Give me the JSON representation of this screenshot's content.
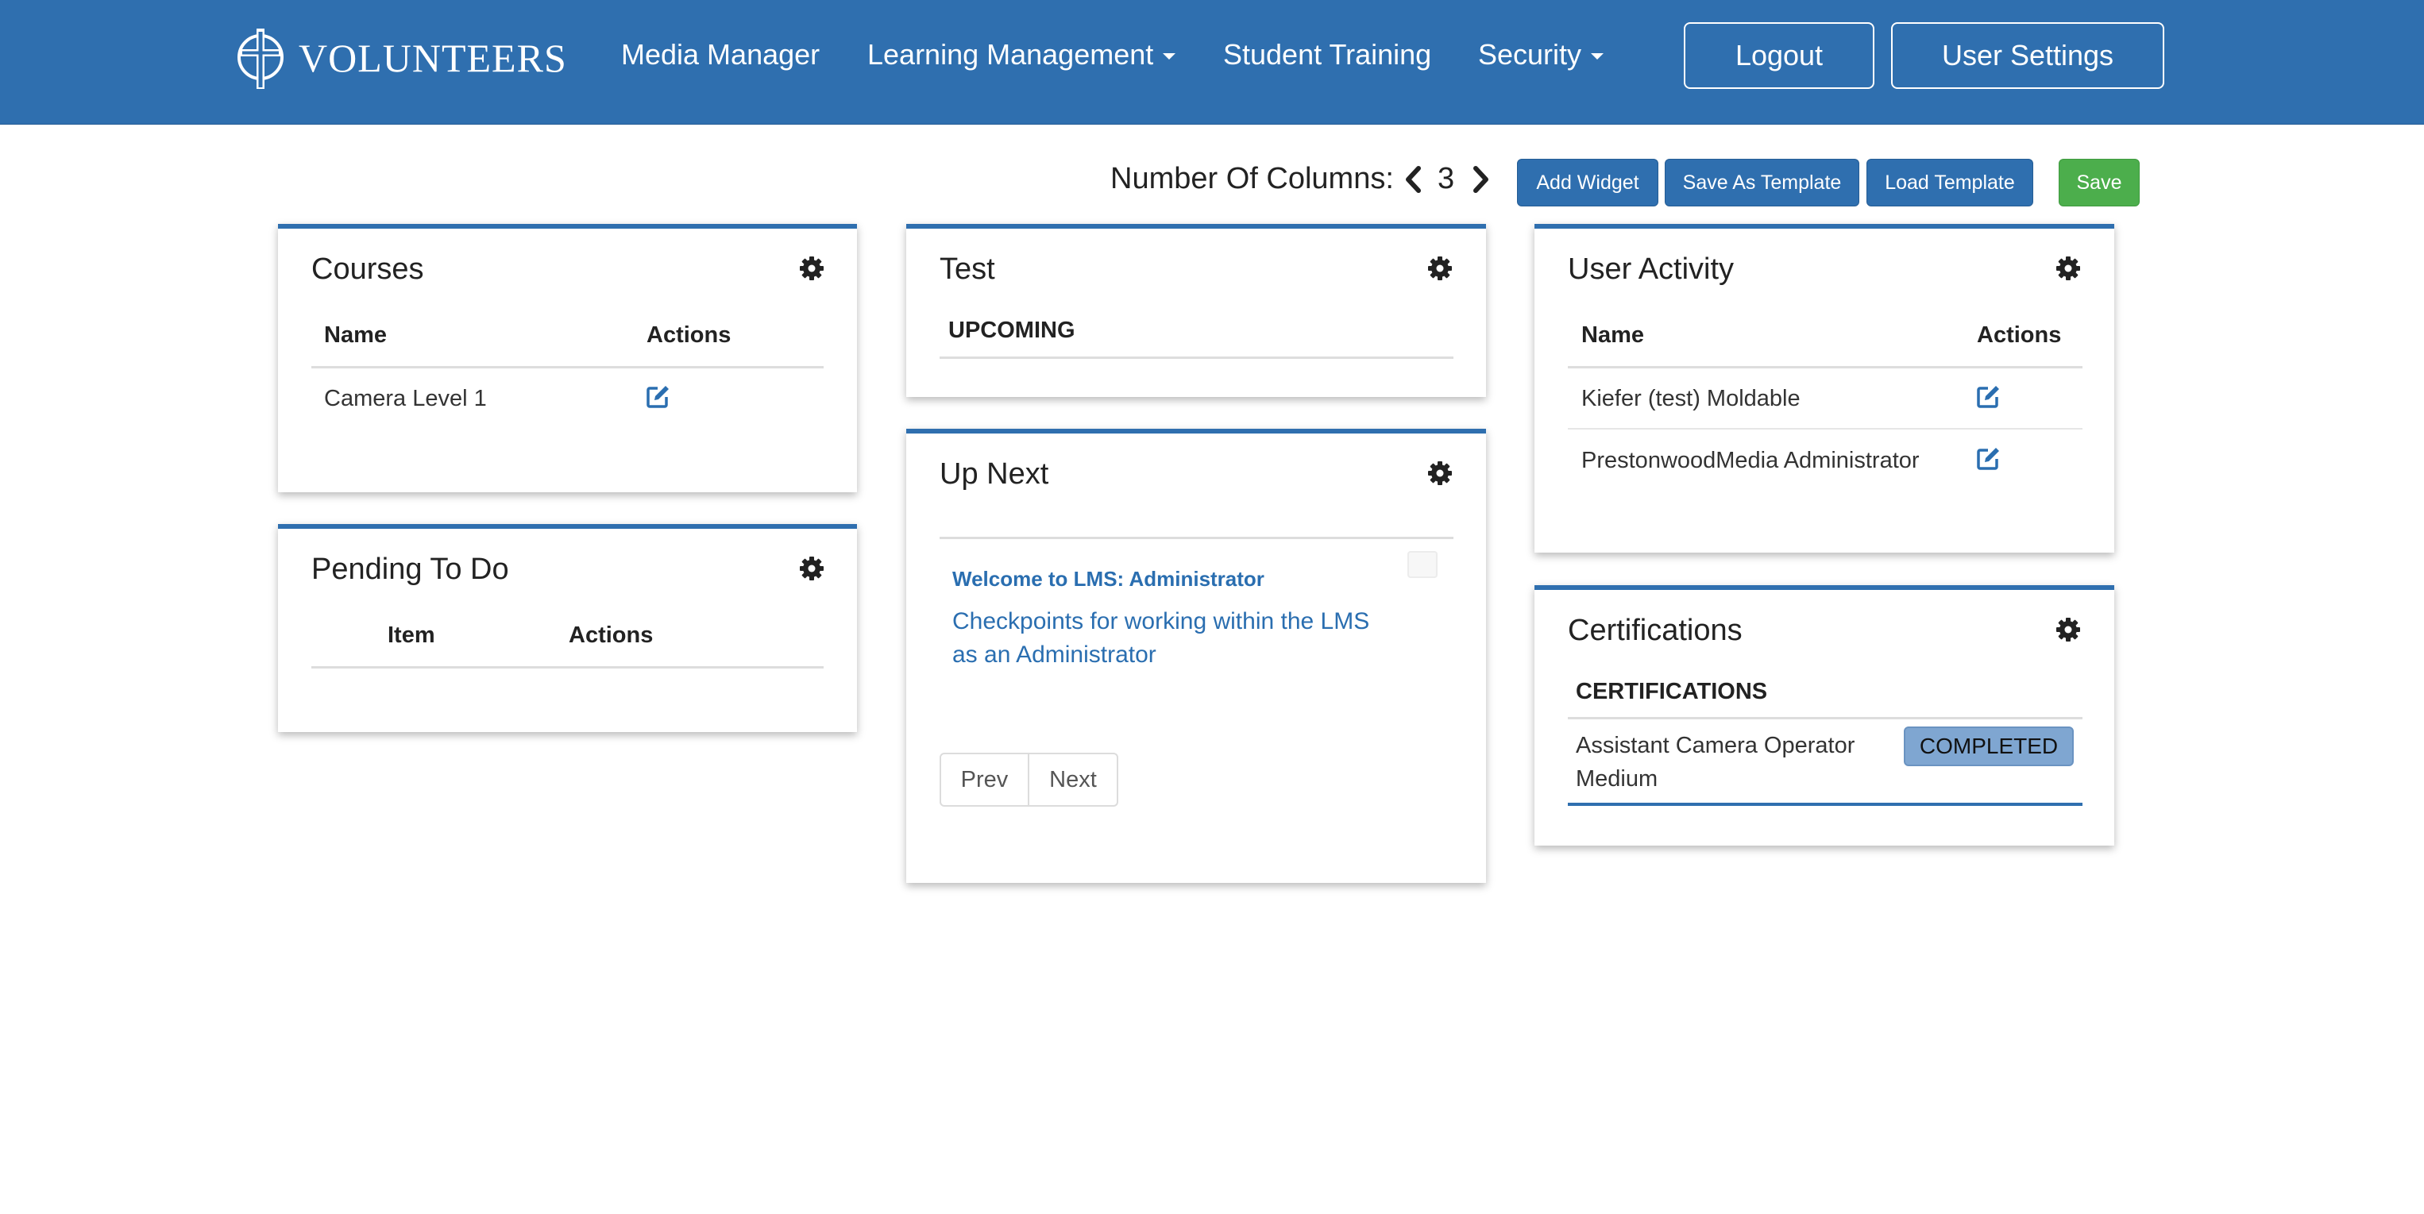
{
  "nav": {
    "brand": "VOLUNTEERS",
    "links": [
      {
        "label": "Media Manager",
        "dropdown": false
      },
      {
        "label": "Learning Management",
        "dropdown": true
      },
      {
        "label": "Student Training",
        "dropdown": false
      },
      {
        "label": "Security",
        "dropdown": true
      }
    ],
    "logout": "Logout",
    "user_settings": "User Settings"
  },
  "toolbar": {
    "columns_label": "Number Of Columns:",
    "columns_value": "3",
    "add_widget": "Add Widget",
    "save_as_template": "Save As Template",
    "load_template": "Load Template",
    "save": "Save"
  },
  "widgets": {
    "courses": {
      "title": "Courses",
      "headers": [
        "Name",
        "Actions"
      ],
      "rows": [
        {
          "name": "Camera Level 1"
        }
      ]
    },
    "pending": {
      "title": "Pending To Do",
      "headers": [
        "Item",
        "Actions"
      ]
    },
    "test": {
      "title": "Test",
      "header": "UPCOMING"
    },
    "upnext": {
      "title": "Up Next",
      "item_title": "Welcome to LMS: Administrator",
      "item_desc_line1": "Checkpoints for working within the LMS",
      "item_desc_line2": "as an Administrator",
      "prev": "Prev",
      "next": "Next"
    },
    "user_activity": {
      "title": "User Activity",
      "headers": [
        "Name",
        "Actions"
      ],
      "rows": [
        {
          "name": "Kiefer (test) Moldable"
        },
        {
          "name": "PrestonwoodMedia Administrator"
        }
      ]
    },
    "certifications": {
      "title": "Certifications",
      "header": "CERTIFICATIONS",
      "rows": [
        {
          "line1": "Assistant Camera Operator",
          "line2": "Medium",
          "status": "COMPLETED"
        }
      ]
    }
  },
  "colors": {
    "navbar": "#2f6faf",
    "primary_button": "#2f6faf",
    "save_button": "#4cae4c",
    "link": "#2a6eb0",
    "completed_badge": "#7fa6d1"
  }
}
